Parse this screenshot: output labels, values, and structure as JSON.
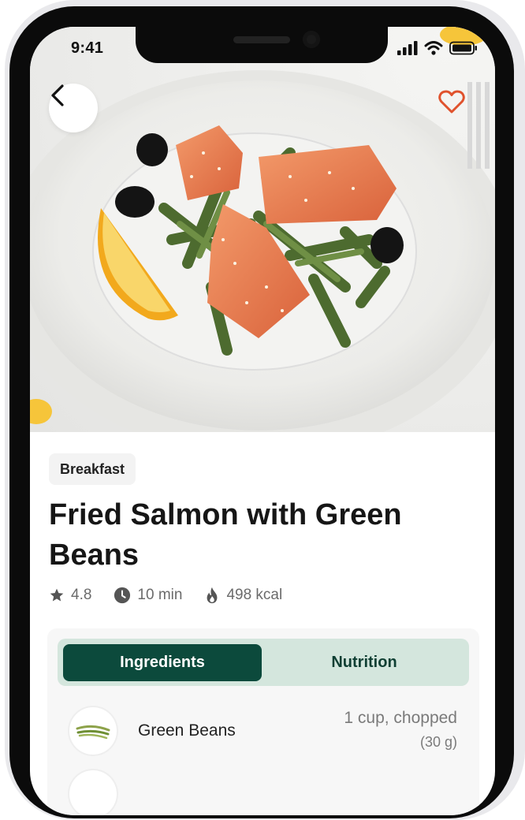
{
  "status_bar": {
    "time": "9:41"
  },
  "hero": {
    "image_alt": "Fried salmon with green beans, olives and lemon on a white plate"
  },
  "recipe": {
    "category": "Breakfast",
    "title": "Fried Salmon with Green Beans",
    "rating": "4.8",
    "duration": "10 min",
    "calories": "498 kcal"
  },
  "tabs": [
    {
      "label": "Ingredients",
      "active": true
    },
    {
      "label": "Nutrition",
      "active": false
    }
  ],
  "ingredients": [
    {
      "name": "Green Beans",
      "quantity": "1 cup, chopped",
      "grams": "(30 g)"
    }
  ],
  "colors": {
    "accent": "#0c4a3c",
    "tab_background": "#d4e6dd",
    "favorite": "#e0522d"
  },
  "icons": {
    "back": "chevron-left-icon",
    "favorite": "heart-outline-icon",
    "rating": "star-icon",
    "duration": "clock-icon",
    "calories": "flame-icon"
  }
}
